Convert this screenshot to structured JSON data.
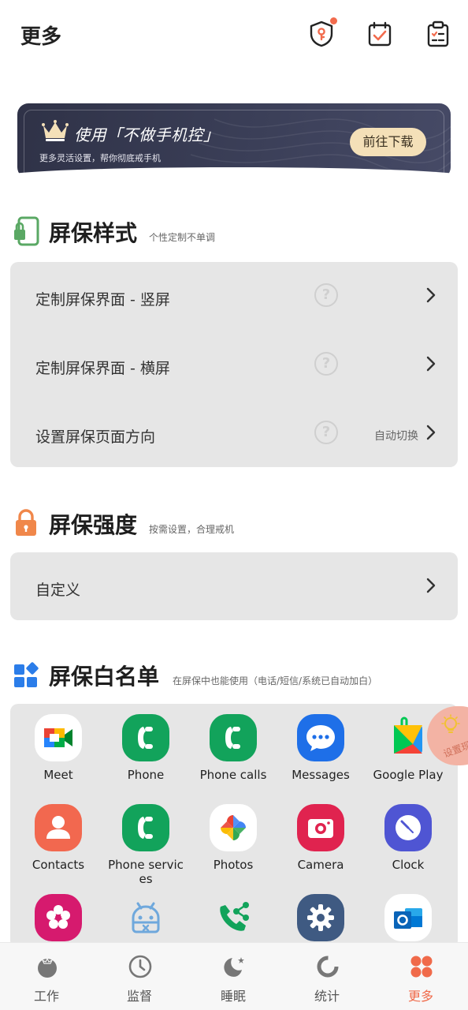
{
  "header": {
    "title": "更多"
  },
  "banner": {
    "title": "使用「不做手机控」",
    "subtitle": "更多灵活设置，帮你彻底戒手机",
    "button": "前往下载"
  },
  "sections": {
    "style": {
      "title": "屏保样式",
      "subtitle": "个性定制不单调",
      "rows": [
        {
          "label": "定制屏保界面 - 竖屏",
          "value": ""
        },
        {
          "label": "定制屏保界面 - 横屏",
          "value": ""
        },
        {
          "label": "设置屏保页面方向",
          "value": "自动切换"
        }
      ]
    },
    "strength": {
      "title": "屏保强度",
      "subtitle": "按需设置，合理戒机",
      "rows": [
        {
          "label": "自定义"
        }
      ]
    },
    "whitelist": {
      "title": "屏保白名单",
      "subtitle": "在屏保中也能使用（电话/短信/系统已自动加白）",
      "apps": [
        {
          "label": "Meet",
          "icon": "google-meet-icon"
        },
        {
          "label": "Phone",
          "icon": "phone-icon"
        },
        {
          "label": "Phone calls",
          "icon": "phone-calls-icon"
        },
        {
          "label": "Messages",
          "icon": "messages-icon"
        },
        {
          "label": "Google Play",
          "icon": "google-play-icon"
        },
        {
          "label": "Contacts",
          "icon": "contacts-icon"
        },
        {
          "label": "Phone services",
          "icon": "phone-services-icon"
        },
        {
          "label": "Photos",
          "icon": "google-photos-icon"
        },
        {
          "label": "Camera",
          "icon": "camera-icon"
        },
        {
          "label": "Clock",
          "icon": "clock-icon"
        },
        {
          "label": "",
          "icon": "flower-app-icon"
        },
        {
          "label": "",
          "icon": "android-robot-icon"
        },
        {
          "label": "",
          "icon": "call-share-icon"
        },
        {
          "label": "",
          "icon": "settings-icon"
        },
        {
          "label": "",
          "icon": "outlook-icon"
        }
      ]
    }
  },
  "floating": {
    "label": "设置现"
  },
  "tabs": [
    {
      "label": "工作",
      "icon": "tomato-icon"
    },
    {
      "label": "监督",
      "icon": "clock-tab-icon"
    },
    {
      "label": "睡眠",
      "icon": "moon-icon"
    },
    {
      "label": "统计",
      "icon": "ring-chart-icon"
    },
    {
      "label": "更多",
      "icon": "grid-more-icon",
      "active": true
    }
  ],
  "colors": {
    "accent": "#f06a4a",
    "card": "#e6e6e6",
    "banner": "#353950",
    "banner_button": "#f4e0b8"
  }
}
